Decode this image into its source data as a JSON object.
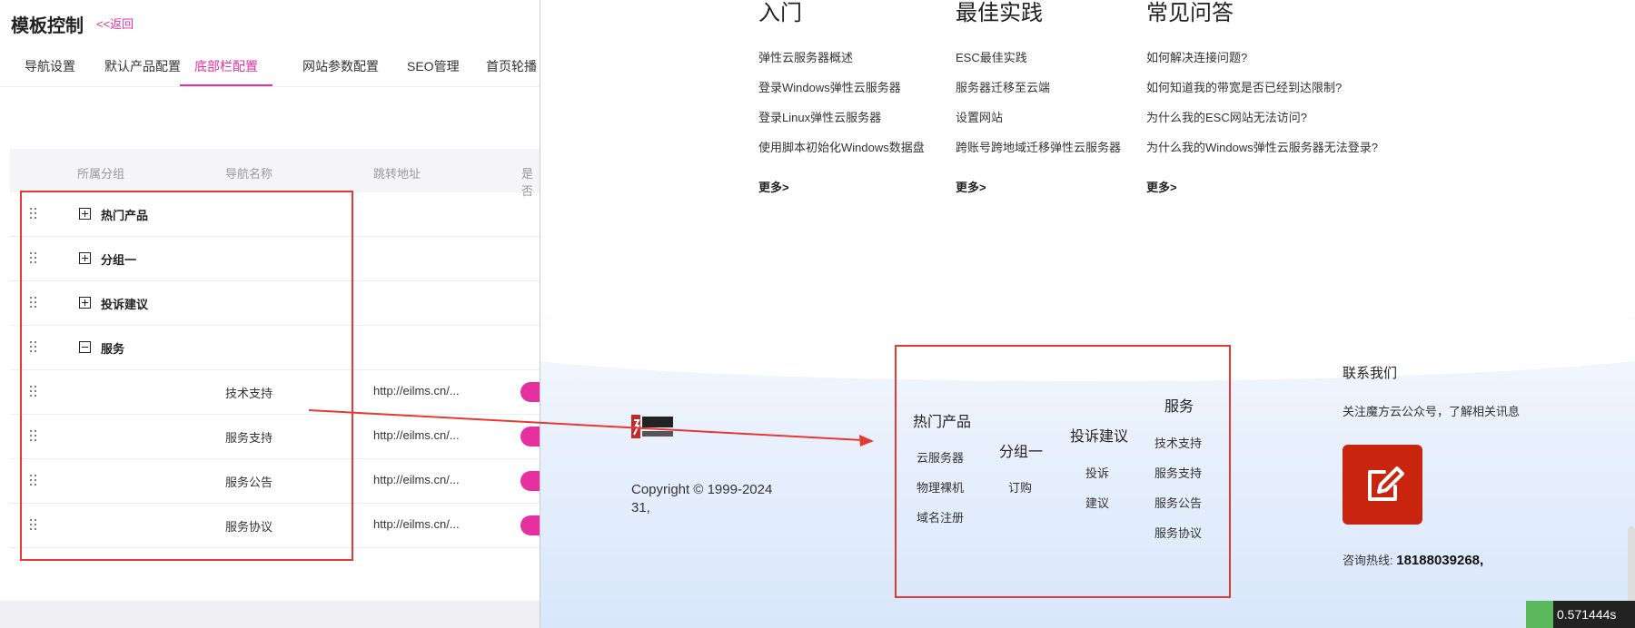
{
  "admin": {
    "title": "模板控制",
    "back_label": "<<返回",
    "tabs": [
      "导航设置",
      "默认产品配置",
      "底部栏配置",
      "网站参数配置",
      "SEO管理",
      "首页轮播"
    ],
    "active_tab": 2,
    "columns": [
      "所属分组",
      "导航名称",
      "跳转地址",
      "是否"
    ],
    "groups": [
      {
        "name": "热门产品",
        "expanded": false
      },
      {
        "name": "分组一",
        "expanded": false
      },
      {
        "name": "投诉建议",
        "expanded": false
      },
      {
        "name": "服务",
        "expanded": true
      }
    ],
    "children": [
      {
        "name": "技术支持",
        "url": "http://eilms.cn/..."
      },
      {
        "name": "服务支持",
        "url": "http://eilms.cn/..."
      },
      {
        "name": "服务公告",
        "url": "http://eilms.cn/..."
      },
      {
        "name": "服务协议",
        "url": "http://eilms.cn/..."
      }
    ],
    "accent": "#e6309f"
  },
  "preview": {
    "columns": [
      {
        "title": "入门",
        "links": [
          "弹性云服务器概述",
          "登录Windows弹性云服务器",
          "登录Linux弹性云服务器",
          "使用脚本初始化Windows数据盘"
        ],
        "more": "更多>"
      },
      {
        "title": "最佳实践",
        "links": [
          "ESC最佳实践",
          "服务器迁移至云端",
          "设置网站",
          "跨账号跨地域迁移弹性云服务器"
        ],
        "more": "更多>"
      },
      {
        "title": "常见问答",
        "links": [
          "如何解决连接问题?",
          "如何知道我的带宽是否已经到达限制?",
          "为什么我的ESC网站无法访问?",
          "为什么我的Windows弹性云服务器无法登录?"
        ],
        "more": "更多>"
      }
    ],
    "footer_groups": [
      {
        "name": "热门产品",
        "items": [
          "云服务器",
          "物理裸机",
          "域名注册"
        ]
      },
      {
        "name": "分组一",
        "items": [
          "订购"
        ]
      },
      {
        "name": "投诉建议",
        "items": [
          "投诉",
          "建议"
        ]
      },
      {
        "name": "服务",
        "items": [
          "技术支持",
          "服务支持",
          "服务公告",
          "服务协议"
        ]
      }
    ],
    "copyright_line1": "Copyright © 1999-2024",
    "copyright_line2": "31,",
    "contact": {
      "title": "联系我们",
      "subtitle": "关注魔方云公众号，了解相关讯息",
      "hotline_label": "咨询热线:",
      "hotline_number": "18188039268,"
    }
  },
  "timing": "0.571444s",
  "annotation_color": "#e53935"
}
